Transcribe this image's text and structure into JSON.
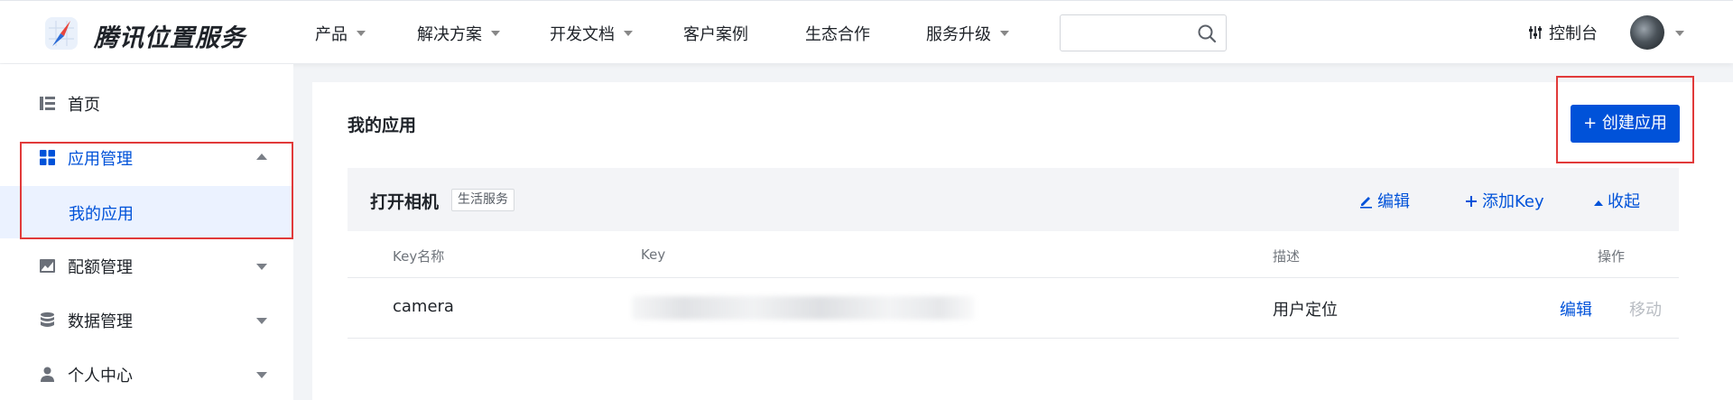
{
  "header": {
    "brand": "腾讯位置服务",
    "nav": [
      {
        "label": "产品",
        "has_dropdown": true
      },
      {
        "label": "解决方案",
        "has_dropdown": true
      },
      {
        "label": "开发文档",
        "has_dropdown": true
      },
      {
        "label": "客户案例",
        "has_dropdown": false
      },
      {
        "label": "生态合作",
        "has_dropdown": false
      },
      {
        "label": "服务升级",
        "has_dropdown": true
      }
    ],
    "search": {
      "value": "",
      "placeholder": ""
    },
    "console_label": "控制台",
    "icons": {
      "search": "search-icon",
      "console": "sliders-icon",
      "avatar": "user-avatar"
    }
  },
  "sidebar": {
    "items": [
      {
        "label": "首页",
        "icon": "home-list-icon",
        "expanded": null
      },
      {
        "label": "应用管理",
        "icon": "grid-apps-icon",
        "expanded": true,
        "active": true
      },
      {
        "label": "配额管理",
        "icon": "chart-area-icon",
        "expanded": false
      },
      {
        "label": "数据管理",
        "icon": "database-icon",
        "expanded": false
      },
      {
        "label": "个人中心",
        "icon": "person-icon",
        "expanded": false
      }
    ],
    "sub_item": {
      "label": "我的应用",
      "selected": true
    }
  },
  "main": {
    "title": "我的应用",
    "create_button": "+ 创建应用",
    "app": {
      "name": "打开相机",
      "tag": "生活服务",
      "actions": {
        "edit": "编辑",
        "add_key": "添加Key",
        "collapse": "收起"
      },
      "table": {
        "headers": [
          "Key名称",
          "Key",
          "描述",
          "操作"
        ],
        "rows": [
          {
            "name": "camera",
            "key": "",
            "description": "用户定位",
            "op_edit": "编辑",
            "op_move": "移动"
          }
        ]
      }
    }
  },
  "colors": {
    "accent": "#0052d9",
    "highlight": "#e13a3a",
    "sub_bg": "#ebf2ff"
  }
}
